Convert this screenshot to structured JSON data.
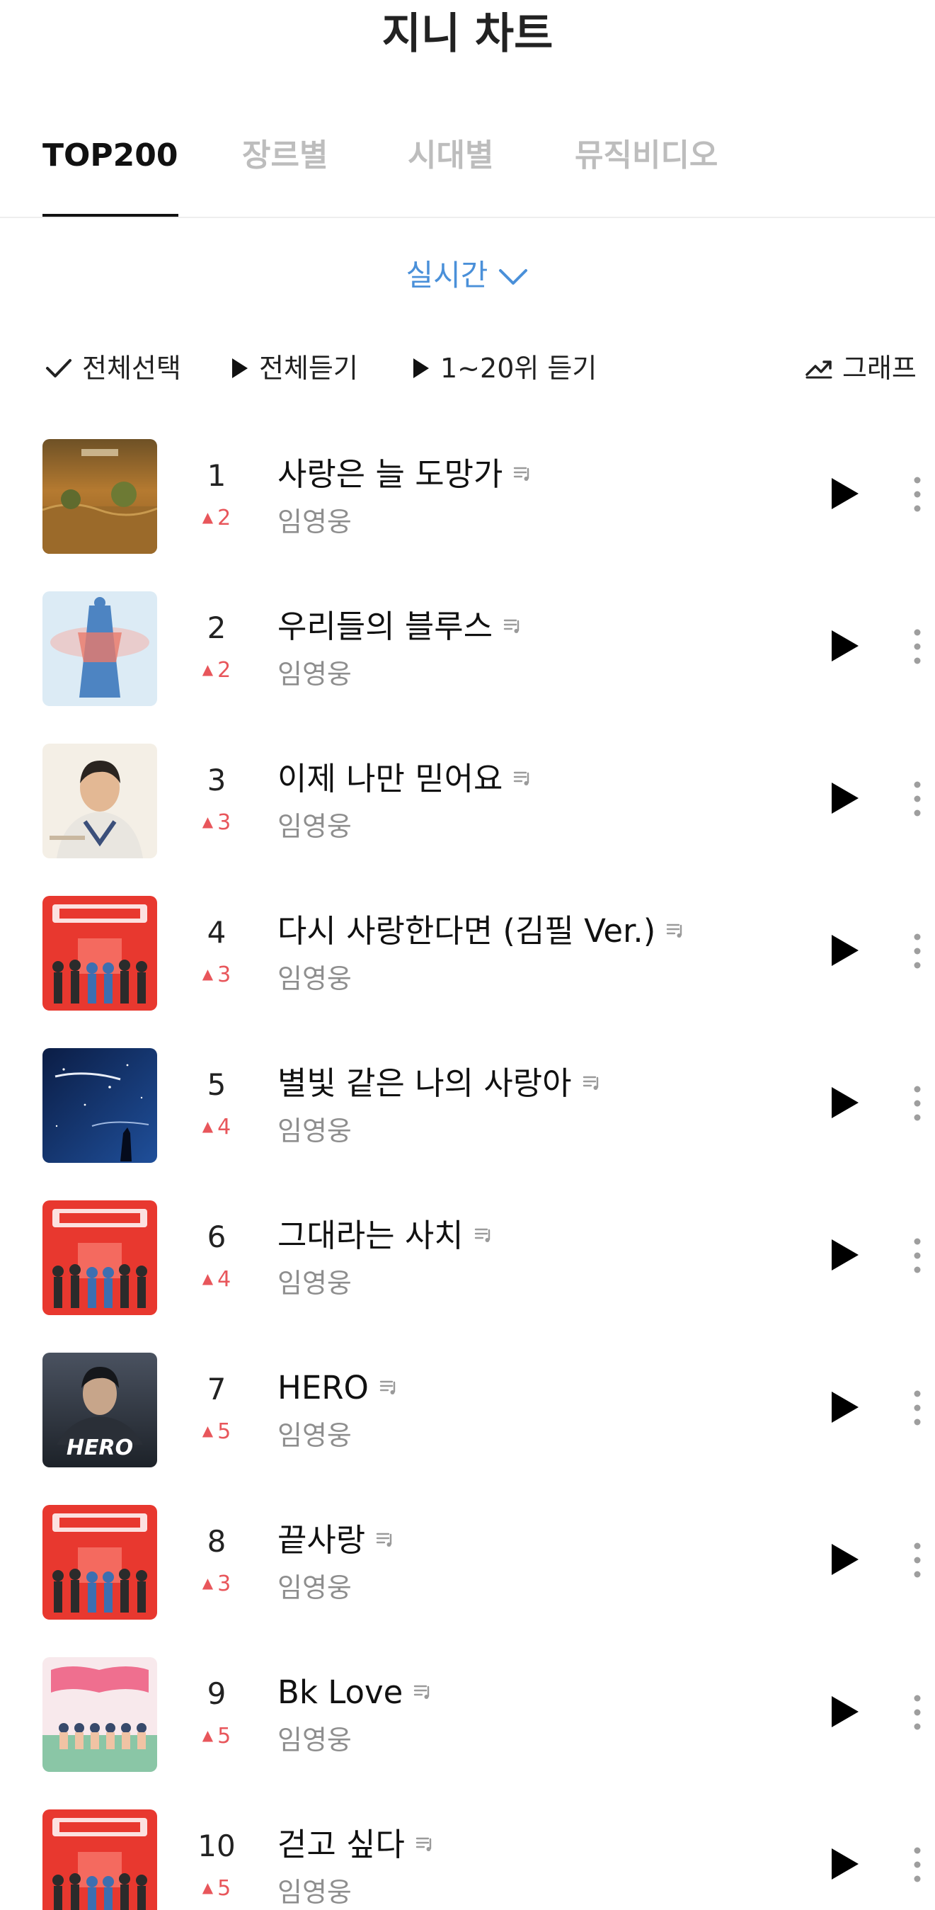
{
  "header": {
    "title": "지니 차트"
  },
  "tabs": [
    {
      "label": "TOP200",
      "active": true
    },
    {
      "label": "장르별",
      "active": false
    },
    {
      "label": "시대별",
      "active": false
    },
    {
      "label": "뮤직비디오",
      "active": false
    }
  ],
  "period": {
    "label": "실시간"
  },
  "toolbar": {
    "select_all": "전체선택",
    "play_all": "전체듣기",
    "play_top20": "1~20위 듣기",
    "graph": "그래프"
  },
  "colors": {
    "accent_blue": "#4a90d9",
    "rank_up_red": "#e8565b",
    "active_tab": "#111111",
    "inactive_tab": "#bdbdbd"
  },
  "tracks": [
    {
      "rank": "1",
      "change": "2",
      "direction": "up",
      "title": "사랑은 늘 도망가",
      "artist": "임영웅",
      "cover": "autumn-field-cover"
    },
    {
      "rank": "2",
      "change": "2",
      "direction": "up",
      "title": "우리들의 블루스",
      "artist": "임영웅",
      "cover": "blue-sky-figure-cover"
    },
    {
      "rank": "3",
      "change": "3",
      "direction": "up",
      "title": "이제 나만 믿어요",
      "artist": "임영웅",
      "cover": "portrait-cover"
    },
    {
      "rank": "4",
      "change": "3",
      "direction": "up",
      "title": "다시 사랑한다면 (김필 Ver.)",
      "artist": "임영웅",
      "cover": "red-group-cover"
    },
    {
      "rank": "5",
      "change": "4",
      "direction": "up",
      "title": "별빛 같은 나의 사랑아",
      "artist": "임영웅",
      "cover": "starry-night-cover"
    },
    {
      "rank": "6",
      "change": "4",
      "direction": "up",
      "title": "그대라는 사치",
      "artist": "임영웅",
      "cover": "red-group-cover"
    },
    {
      "rank": "7",
      "change": "5",
      "direction": "up",
      "title": "HERO",
      "artist": "임영웅",
      "cover": "hero-cover",
      "cover_text": "HERO"
    },
    {
      "rank": "8",
      "change": "3",
      "direction": "up",
      "title": "끝사랑",
      "artist": "임영웅",
      "cover": "red-group-cover"
    },
    {
      "rank": "9",
      "change": "5",
      "direction": "up",
      "title": "Bk Love",
      "artist": "임영웅",
      "cover": "pink-group-cover"
    },
    {
      "rank": "10",
      "change": "5",
      "direction": "up",
      "title": "걷고 싶다",
      "artist": "임영웅",
      "cover": "red-group-cover"
    }
  ]
}
